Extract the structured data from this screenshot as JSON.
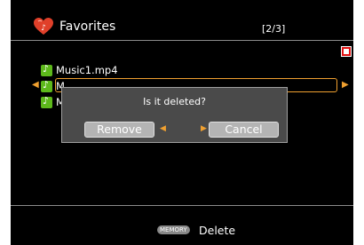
{
  "header": {
    "title": "Favorites",
    "page_indicator": "[2/3]"
  },
  "list": {
    "items": [
      {
        "label": "Music1.mp4",
        "icon": "music-note-icon"
      },
      {
        "label": "M",
        "icon": "music-note-icon",
        "selected": true
      },
      {
        "label": "M",
        "icon": "music-note-icon"
      }
    ]
  },
  "dialog": {
    "message": "Is it deleted?",
    "remove_label": "Remove",
    "cancel_label": "Cancel"
  },
  "footer": {
    "key_label": "MEMORY",
    "action_label": "Delete"
  },
  "colors": {
    "background": "#000000",
    "accent": "#f0a030",
    "note_icon": "#5db81b",
    "record_icon": "#e01010",
    "button": "#b4b4b4",
    "dialog": "#4a4a4a"
  }
}
